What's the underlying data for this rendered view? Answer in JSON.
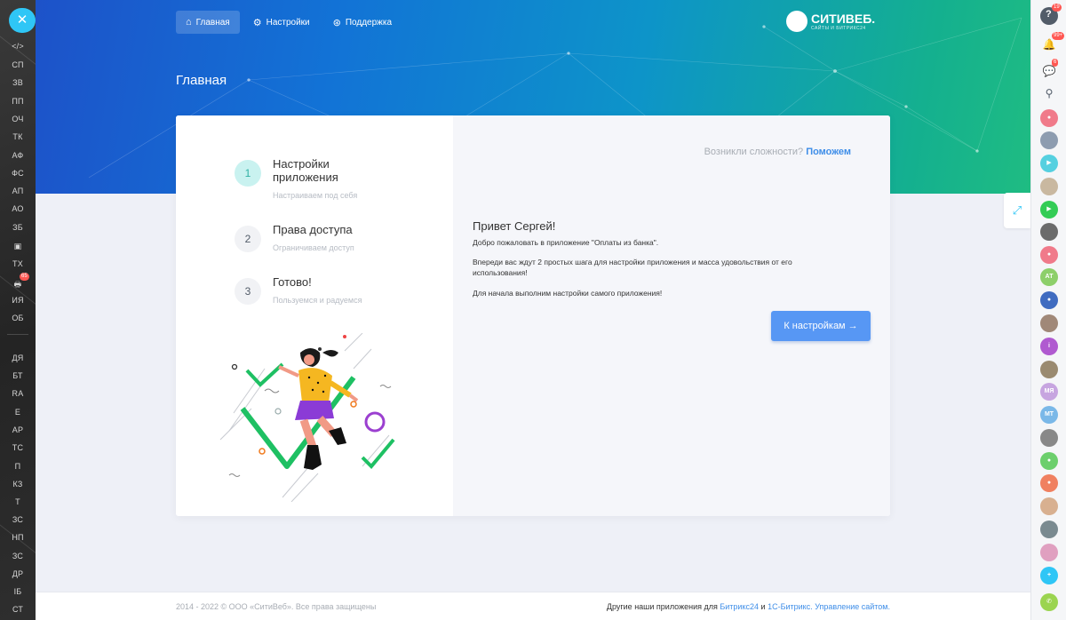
{
  "nav": {
    "items": [
      {
        "label": "Главная",
        "icon": "home-icon"
      },
      {
        "label": "Настройки",
        "icon": "gear-icon"
      },
      {
        "label": "Поддержка",
        "icon": "lifebuoy-icon"
      }
    ]
  },
  "page_title": "Главная",
  "logo": {
    "name": "СИТИВЕБ.",
    "sub": "САЙТЫ И БИТРИКС24"
  },
  "steps": [
    {
      "num": "1",
      "title": "Настройки приложения",
      "sub": "Настраиваем под себя"
    },
    {
      "num": "2",
      "title": "Права доступа",
      "sub": "Ограничиваем доступ"
    },
    {
      "num": "3",
      "title": "Готово!",
      "sub": "Пользуемся и радуемся"
    }
  ],
  "help": {
    "question": "Возникли сложности?",
    "link": "Поможем"
  },
  "welcome": {
    "greeting": "Привет Сергей!",
    "line1": "Добро пожаловать в приложение \"Оплаты из банка\".",
    "line2": "Впереди вас ждут 2 простых шага для настройки приложения и масса удовольствия от его использования!",
    "line3": "Для начала выполним настройки самого приложения!",
    "button": "К настройкам →"
  },
  "footer": {
    "copyright": "2014 - 2022 © ООО «СитиВеб». Все права защищены",
    "other_prefix": "Другие наши приложения для",
    "link1": "Битрикс24",
    "and": "и",
    "link2": "1С-Битрикс. Управление сайтом."
  },
  "left_rail": {
    "close": "✕",
    "items": [
      "</>",
      "СП",
      "ЗВ",
      "ПП",
      "ОЧ",
      "ТК",
      "АФ",
      "ФС",
      "АП",
      "АО",
      "ЗБ",
      "▣",
      "ТХ",
      "🖶",
      "ИЯ",
      "ОБ",
      "ДЯ",
      "БТ",
      "RA",
      "Е",
      "АР",
      "ТС",
      "П",
      "КЗ",
      "Т",
      "ЗС",
      "НП",
      "ЗС",
      "ДР",
      "ІБ",
      "СТ"
    ],
    "badge": "65"
  },
  "right_rail": {
    "help_badge": "19",
    "notify_badge": "99+",
    "chat_badge": "6",
    "avatar_at": "АТ",
    "avatar_mya": "МЯ",
    "avatar_mt": "МТ"
  },
  "colors": {
    "accent": "#5797f4",
    "step_active": "#c9f2f0",
    "brand_blue": "#1d52c9",
    "brand_green": "#1fbc82"
  }
}
